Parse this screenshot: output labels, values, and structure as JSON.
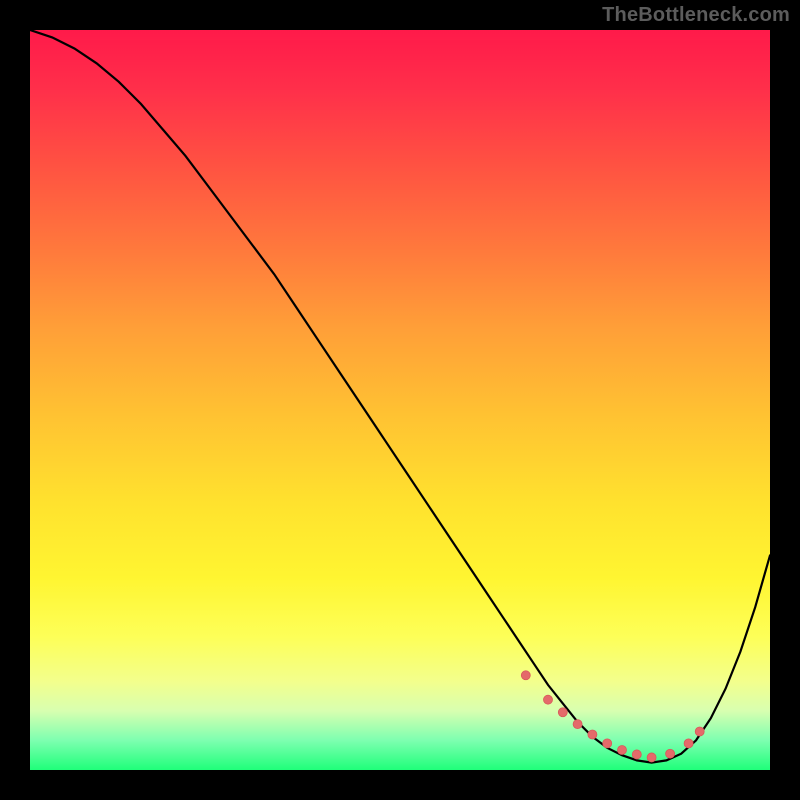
{
  "watermark": "TheBottleneck.com",
  "colors": {
    "curve": "#000000",
    "marker": "#e46a6a",
    "marker_stroke": "#d85a5a"
  },
  "chart_data": {
    "type": "line",
    "title": "",
    "xlabel": "",
    "ylabel": "",
    "xlim": [
      0,
      100
    ],
    "ylim": [
      0,
      100
    ],
    "grid": false,
    "legend": false,
    "series": [
      {
        "name": "curve",
        "x": [
          0,
          3,
          6,
          9,
          12,
          15,
          18,
          21,
          24,
          27,
          30,
          33,
          36,
          39,
          42,
          45,
          48,
          51,
          54,
          57,
          60,
          62,
          64,
          66,
          68,
          70,
          72,
          74,
          76,
          78,
          80,
          82,
          84,
          86,
          88,
          90,
          92,
          94,
          96,
          98,
          100
        ],
        "y": [
          100,
          99,
          97.5,
          95.5,
          93,
          90,
          86.5,
          83,
          79,
          75,
          71,
          67,
          62.5,
          58,
          53.5,
          49,
          44.5,
          40,
          35.5,
          31,
          26.5,
          23.5,
          20.5,
          17.5,
          14.5,
          11.5,
          9,
          6.5,
          4.5,
          3,
          2,
          1.3,
          1,
          1.3,
          2.2,
          4,
          7,
          11,
          16,
          22,
          29
        ]
      }
    ],
    "markers": {
      "name": "highlight-band",
      "points": [
        {
          "x": 67,
          "y": 12.8
        },
        {
          "x": 70,
          "y": 9.5
        },
        {
          "x": 72,
          "y": 7.8
        },
        {
          "x": 74,
          "y": 6.2
        },
        {
          "x": 76,
          "y": 4.8
        },
        {
          "x": 78,
          "y": 3.6
        },
        {
          "x": 80,
          "y": 2.7
        },
        {
          "x": 82,
          "y": 2.1
        },
        {
          "x": 84,
          "y": 1.7
        },
        {
          "x": 86.5,
          "y": 2.2
        },
        {
          "x": 89,
          "y": 3.6
        },
        {
          "x": 90.5,
          "y": 5.2
        }
      ],
      "radius": 4.5
    }
  }
}
